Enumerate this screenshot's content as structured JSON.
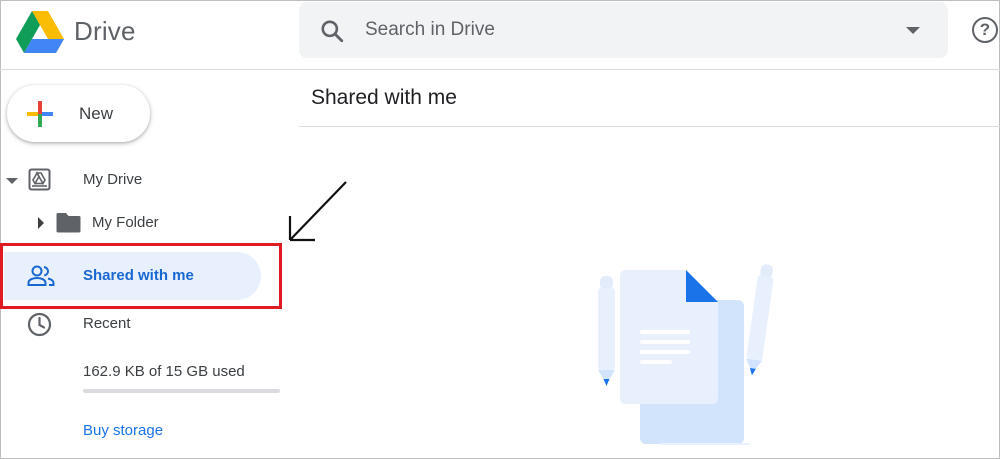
{
  "app": {
    "title": "Drive"
  },
  "search": {
    "placeholder": "Search in Drive"
  },
  "header": {
    "help_icon": "help-icon"
  },
  "sidebar": {
    "new_button_label": "New",
    "items": [
      {
        "label": "My Drive",
        "icon": "my-drive-icon",
        "expanded": true
      },
      {
        "label": "My Folder",
        "icon": "folder-icon",
        "expanded": false
      },
      {
        "label": "Shared with me",
        "icon": "shared-people-icon",
        "selected": true
      },
      {
        "label": "Recent",
        "icon": "clock-icon"
      }
    ],
    "storage": {
      "text": "162.9 KB of 15 GB used",
      "used_fraction": 1e-05
    },
    "buy_storage_label": "Buy storage"
  },
  "main": {
    "page_title": "Shared with me"
  },
  "colors": {
    "accent": "#1a73e8",
    "selected_bg": "#e8f0fe",
    "selected_text": "#1967d2",
    "annotation_red": "#e01b24"
  }
}
